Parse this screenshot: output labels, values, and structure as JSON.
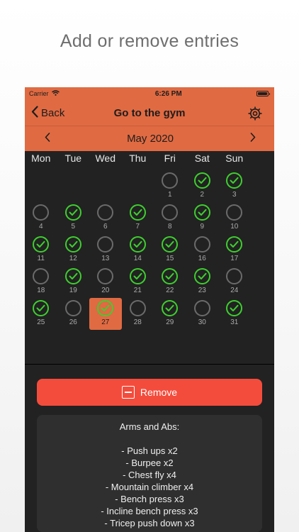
{
  "headline": "Add or remove entries",
  "status_bar": {
    "carrier": "Carrier",
    "time": "6:26 PM"
  },
  "nav": {
    "back_label": "Back",
    "title": "Go to the gym",
    "settings_icon": "gear-icon"
  },
  "calendar": {
    "month_label": "May 2020",
    "weekdays": [
      "Mon",
      "Tue",
      "Wed",
      "Thu",
      "Fri",
      "Sat",
      "Sun"
    ],
    "leading_blank_days": 4,
    "days": [
      {
        "n": "1",
        "done": false
      },
      {
        "n": "2",
        "done": true
      },
      {
        "n": "3",
        "done": true
      },
      {
        "n": "4",
        "done": false
      },
      {
        "n": "5",
        "done": true
      },
      {
        "n": "6",
        "done": false
      },
      {
        "n": "7",
        "done": true
      },
      {
        "n": "8",
        "done": false
      },
      {
        "n": "9",
        "done": true
      },
      {
        "n": "10",
        "done": false
      },
      {
        "n": "11",
        "done": true
      },
      {
        "n": "12",
        "done": true
      },
      {
        "n": "13",
        "done": false
      },
      {
        "n": "14",
        "done": true
      },
      {
        "n": "15",
        "done": true
      },
      {
        "n": "16",
        "done": false
      },
      {
        "n": "17",
        "done": true
      },
      {
        "n": "18",
        "done": false
      },
      {
        "n": "19",
        "done": true
      },
      {
        "n": "20",
        "done": false
      },
      {
        "n": "21",
        "done": true
      },
      {
        "n": "22",
        "done": true
      },
      {
        "n": "23",
        "done": true
      },
      {
        "n": "24",
        "done": false
      },
      {
        "n": "25",
        "done": true
      },
      {
        "n": "26",
        "done": false
      },
      {
        "n": "27",
        "done": true,
        "selected": true
      },
      {
        "n": "28",
        "done": false
      },
      {
        "n": "29",
        "done": true
      },
      {
        "n": "30",
        "done": false
      },
      {
        "n": "31",
        "done": true
      }
    ]
  },
  "remove_button": {
    "label": "Remove"
  },
  "notes": {
    "title": "Arms and Abs:",
    "lines": [
      "- Push ups x2",
      "- Burpee x2",
      "- Chest fly x4",
      "- Mountain climber x4",
      "- Bench press x3",
      "- Incline bench press x3",
      "- Tricep push down x3"
    ]
  },
  "colors": {
    "accent": "#e06a42",
    "done": "#3ecf2f",
    "remove": "#f44c3c",
    "panel": "#222222"
  }
}
